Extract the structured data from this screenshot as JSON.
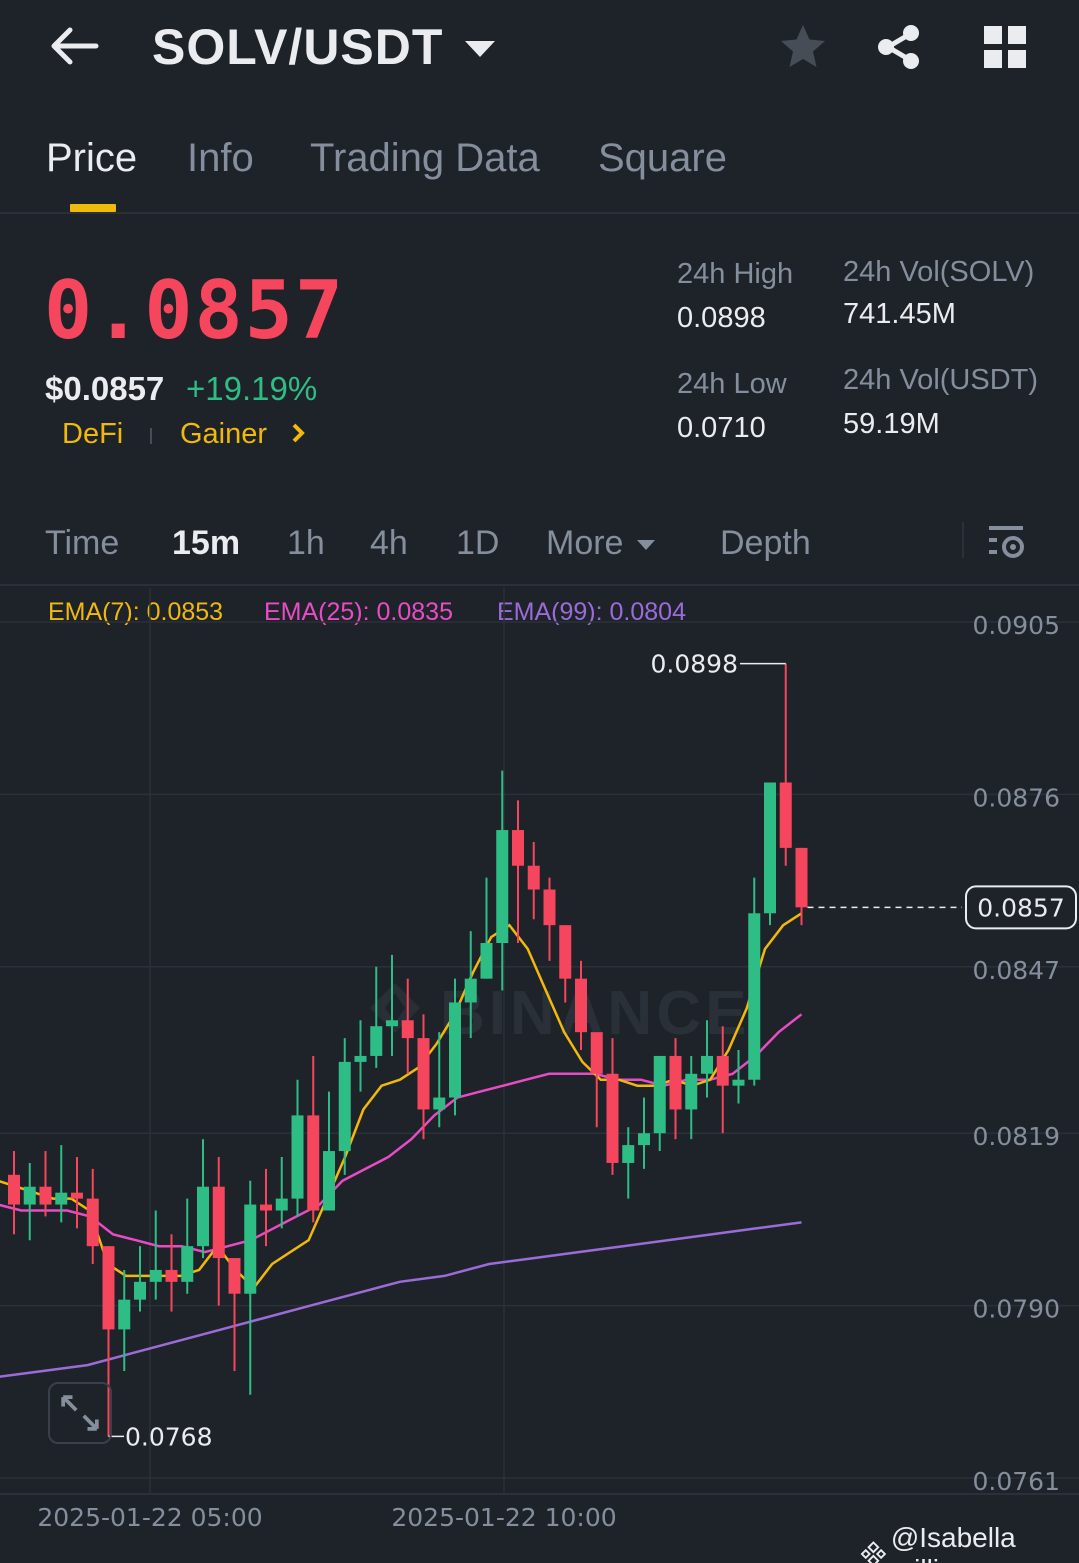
{
  "header": {
    "pair": "SOLV/USDT"
  },
  "tabs": [
    {
      "label": "Price",
      "active": true
    },
    {
      "label": "Info",
      "active": false
    },
    {
      "label": "Trading Data",
      "active": false
    },
    {
      "label": "Square",
      "active": false
    }
  ],
  "price": {
    "last": "0.0857",
    "usd": "$0.0857",
    "change": "+19.19%",
    "tags": [
      "DeFi",
      "Gainer"
    ]
  },
  "stats": {
    "high_label": "24h High",
    "high_value": "0.0898",
    "low_label": "24h Low",
    "low_value": "0.0710",
    "vol_base_label": "24h Vol(SOLV)",
    "vol_base_value": "741.45M",
    "vol_quote_label": "24h Vol(USDT)",
    "vol_quote_value": "59.19M"
  },
  "intervals": {
    "items": [
      "Time",
      "15m",
      "1h",
      "4h",
      "1D",
      "More",
      "Depth"
    ],
    "active": "15m"
  },
  "ema": {
    "ema7": "EMA(7): 0.0853",
    "ema25": "EMA(25): 0.0835",
    "ema99": "EMA(99): 0.0804"
  },
  "watermark": {
    "brand": "BINANCE",
    "user": "@Isabella millie"
  },
  "colors": {
    "up": "#2ebd85",
    "down": "#f6465d",
    "accent": "#f0b90b",
    "ema7": "#f0b90b",
    "ema25": "#e84cc5",
    "ema99": "#9b6bd8",
    "background": "#1e2329"
  },
  "icons": [
    "arrow-left-icon",
    "caret-down-icon",
    "star-icon",
    "share-icon",
    "grid-icon",
    "chart-settings-icon",
    "expand-icon",
    "binance-logo-icon"
  ],
  "chart_data": {
    "type": "candlestick",
    "y_ticks": [
      "0.0905",
      "0.0876",
      "0.0847",
      "0.0819",
      "0.0790",
      "0.0761"
    ],
    "ylim": [
      0.0761,
      0.0905
    ],
    "x_ticks": [
      "2025-01-22 05:00",
      "2025-01-22 10:00"
    ],
    "current_price": "0.0857",
    "max_label": "0.0898",
    "min_label": "0.0768",
    "grid": true,
    "candles": [
      [
        0.0812,
        0.0807,
        0.0816,
        0.0802
      ],
      [
        0.0807,
        0.081,
        0.0814,
        0.0801
      ],
      [
        0.081,
        0.0807,
        0.0816,
        0.0805
      ],
      [
        0.0807,
        0.0809,
        0.0817,
        0.0804
      ],
      [
        0.0809,
        0.0808,
        0.0815,
        0.0803
      ],
      [
        0.0808,
        0.08,
        0.0813,
        0.0797
      ],
      [
        0.08,
        0.0786,
        0.08,
        0.0768
      ],
      [
        0.0786,
        0.0791,
        0.0796,
        0.0779
      ],
      [
        0.0791,
        0.0794,
        0.08,
        0.0789
      ],
      [
        0.0794,
        0.0796,
        0.0806,
        0.0791
      ],
      [
        0.0796,
        0.0794,
        0.0802,
        0.0789
      ],
      [
        0.0794,
        0.08,
        0.0808,
        0.0792
      ],
      [
        0.08,
        0.081,
        0.0818,
        0.0798
      ],
      [
        0.081,
        0.0798,
        0.0815,
        0.079
      ],
      [
        0.0798,
        0.0792,
        0.0796,
        0.0779
      ],
      [
        0.0792,
        0.0807,
        0.0811,
        0.0775
      ],
      [
        0.0807,
        0.0806,
        0.0813,
        0.08
      ],
      [
        0.0806,
        0.0808,
        0.0815,
        0.0803
      ],
      [
        0.0808,
        0.0822,
        0.0828,
        0.0805
      ],
      [
        0.0822,
        0.0806,
        0.0832,
        0.0804
      ],
      [
        0.0806,
        0.0816,
        0.0826,
        0.0806
      ],
      [
        0.0816,
        0.0831,
        0.0835,
        0.0812
      ],
      [
        0.0831,
        0.0832,
        0.0838,
        0.0826
      ],
      [
        0.0832,
        0.0837,
        0.0847,
        0.083
      ],
      [
        0.0837,
        0.0838,
        0.0849,
        0.0832
      ],
      [
        0.0838,
        0.0835,
        0.0845,
        0.0829
      ],
      [
        0.0835,
        0.0823,
        0.0839,
        0.0818
      ],
      [
        0.0823,
        0.0825,
        0.0836,
        0.082
      ],
      [
        0.0825,
        0.0841,
        0.0845,
        0.0822
      ],
      [
        0.0841,
        0.0845,
        0.0853,
        0.0835
      ],
      [
        0.0845,
        0.0851,
        0.0862,
        0.0845
      ],
      [
        0.0851,
        0.087,
        0.088,
        0.0843
      ],
      [
        0.087,
        0.0864,
        0.0875,
        0.0851
      ],
      [
        0.0864,
        0.086,
        0.0868,
        0.0855
      ],
      [
        0.086,
        0.0854,
        0.0862,
        0.0848
      ],
      [
        0.0854,
        0.0845,
        0.0853,
        0.0841
      ],
      [
        0.0845,
        0.0836,
        0.0848,
        0.0833
      ],
      [
        0.0836,
        0.0829,
        0.0833,
        0.082
      ],
      [
        0.0829,
        0.0814,
        0.0835,
        0.0812
      ],
      [
        0.0814,
        0.0817,
        0.082,
        0.0808
      ],
      [
        0.0817,
        0.0819,
        0.0825,
        0.0813
      ],
      [
        0.0819,
        0.0832,
        0.0832,
        0.0816
      ],
      [
        0.0832,
        0.0823,
        0.0835,
        0.0818
      ],
      [
        0.0823,
        0.0829,
        0.0832,
        0.0818
      ],
      [
        0.0829,
        0.0832,
        0.0838,
        0.0825
      ],
      [
        0.0832,
        0.0827,
        0.0837,
        0.0819
      ],
      [
        0.0827,
        0.0828,
        0.0833,
        0.0824
      ],
      [
        0.0828,
        0.0856,
        0.0862,
        0.0827
      ],
      [
        0.0856,
        0.0878,
        0.0878,
        0.0854
      ],
      [
        0.0878,
        0.0867,
        0.0898,
        0.0864
      ],
      [
        0.0867,
        0.0857,
        0.0867,
        0.0854
      ]
    ],
    "ema7": [
      0.0811,
      0.081,
      0.0809,
      0.0808,
      0.0808,
      0.0806,
      0.0797,
      0.0795,
      0.0795,
      0.0795,
      0.0795,
      0.0796,
      0.08,
      0.0796,
      0.0793,
      0.0797,
      0.0799,
      0.0801,
      0.0808,
      0.0815,
      0.0823,
      0.0827,
      0.0828,
      0.083,
      0.0834,
      0.0839,
      0.0846,
      0.0852,
      0.0854,
      0.085,
      0.0843,
      0.0836,
      0.0831,
      0.0828,
      0.0828,
      0.0827,
      0.0827,
      0.0828,
      0.0827,
      0.0828,
      0.0833,
      0.084,
      0.085,
      0.0854,
      0.0856
    ],
    "ema25": [
      0.0807,
      0.0806,
      0.0806,
      0.0806,
      0.0805,
      0.0802,
      0.0801,
      0.08,
      0.08,
      0.0799,
      0.08,
      0.0801,
      0.0803,
      0.0805,
      0.0807,
      0.0811,
      0.0813,
      0.0815,
      0.0818,
      0.0822,
      0.0825,
      0.0826,
      0.0827,
      0.0828,
      0.0829,
      0.0829,
      0.0829,
      0.0828,
      0.0828,
      0.0827,
      0.0828,
      0.0828,
      0.0829,
      0.0832,
      0.0836,
      0.0839
    ],
    "ema99": [
      0.0778,
      0.0779,
      0.078,
      0.0782,
      0.0784,
      0.0786,
      0.0788,
      0.079,
      0.0792,
      0.0794,
      0.0795,
      0.0797,
      0.0798,
      0.0799,
      0.08,
      0.0801,
      0.0802,
      0.0803,
      0.0804
    ]
  }
}
